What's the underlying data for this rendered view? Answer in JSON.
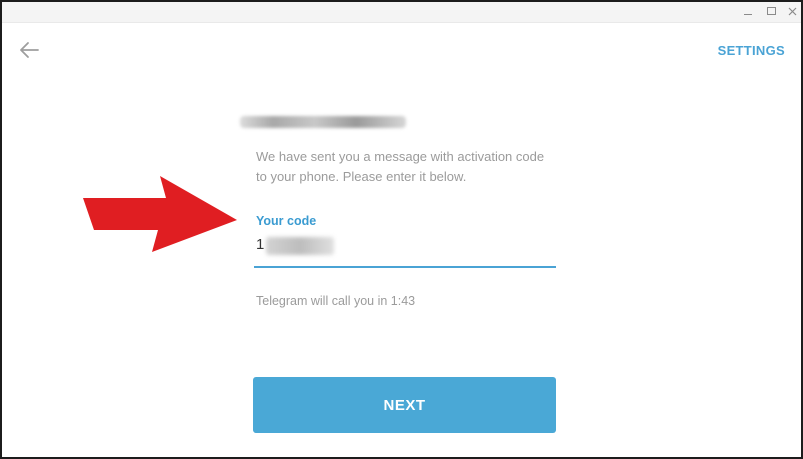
{
  "header": {
    "settings_label": "SETTINGS"
  },
  "icons": {
    "back": "arrow-left-icon",
    "minimize": "minimize-icon",
    "maximize": "maximize-icon",
    "close": "close-icon",
    "annotation": "red-arrow-icon"
  },
  "colors": {
    "accent": "#4aa3d5",
    "button": "#4aa8d6",
    "annotation_arrow": "#e01e22"
  },
  "main": {
    "description": "We have sent you a message with activation code to your phone. Please enter it below.",
    "code_label": "Your code",
    "code_value": "1",
    "call_timer": "Telegram will call you in 1:43",
    "next_label": "NEXT"
  }
}
